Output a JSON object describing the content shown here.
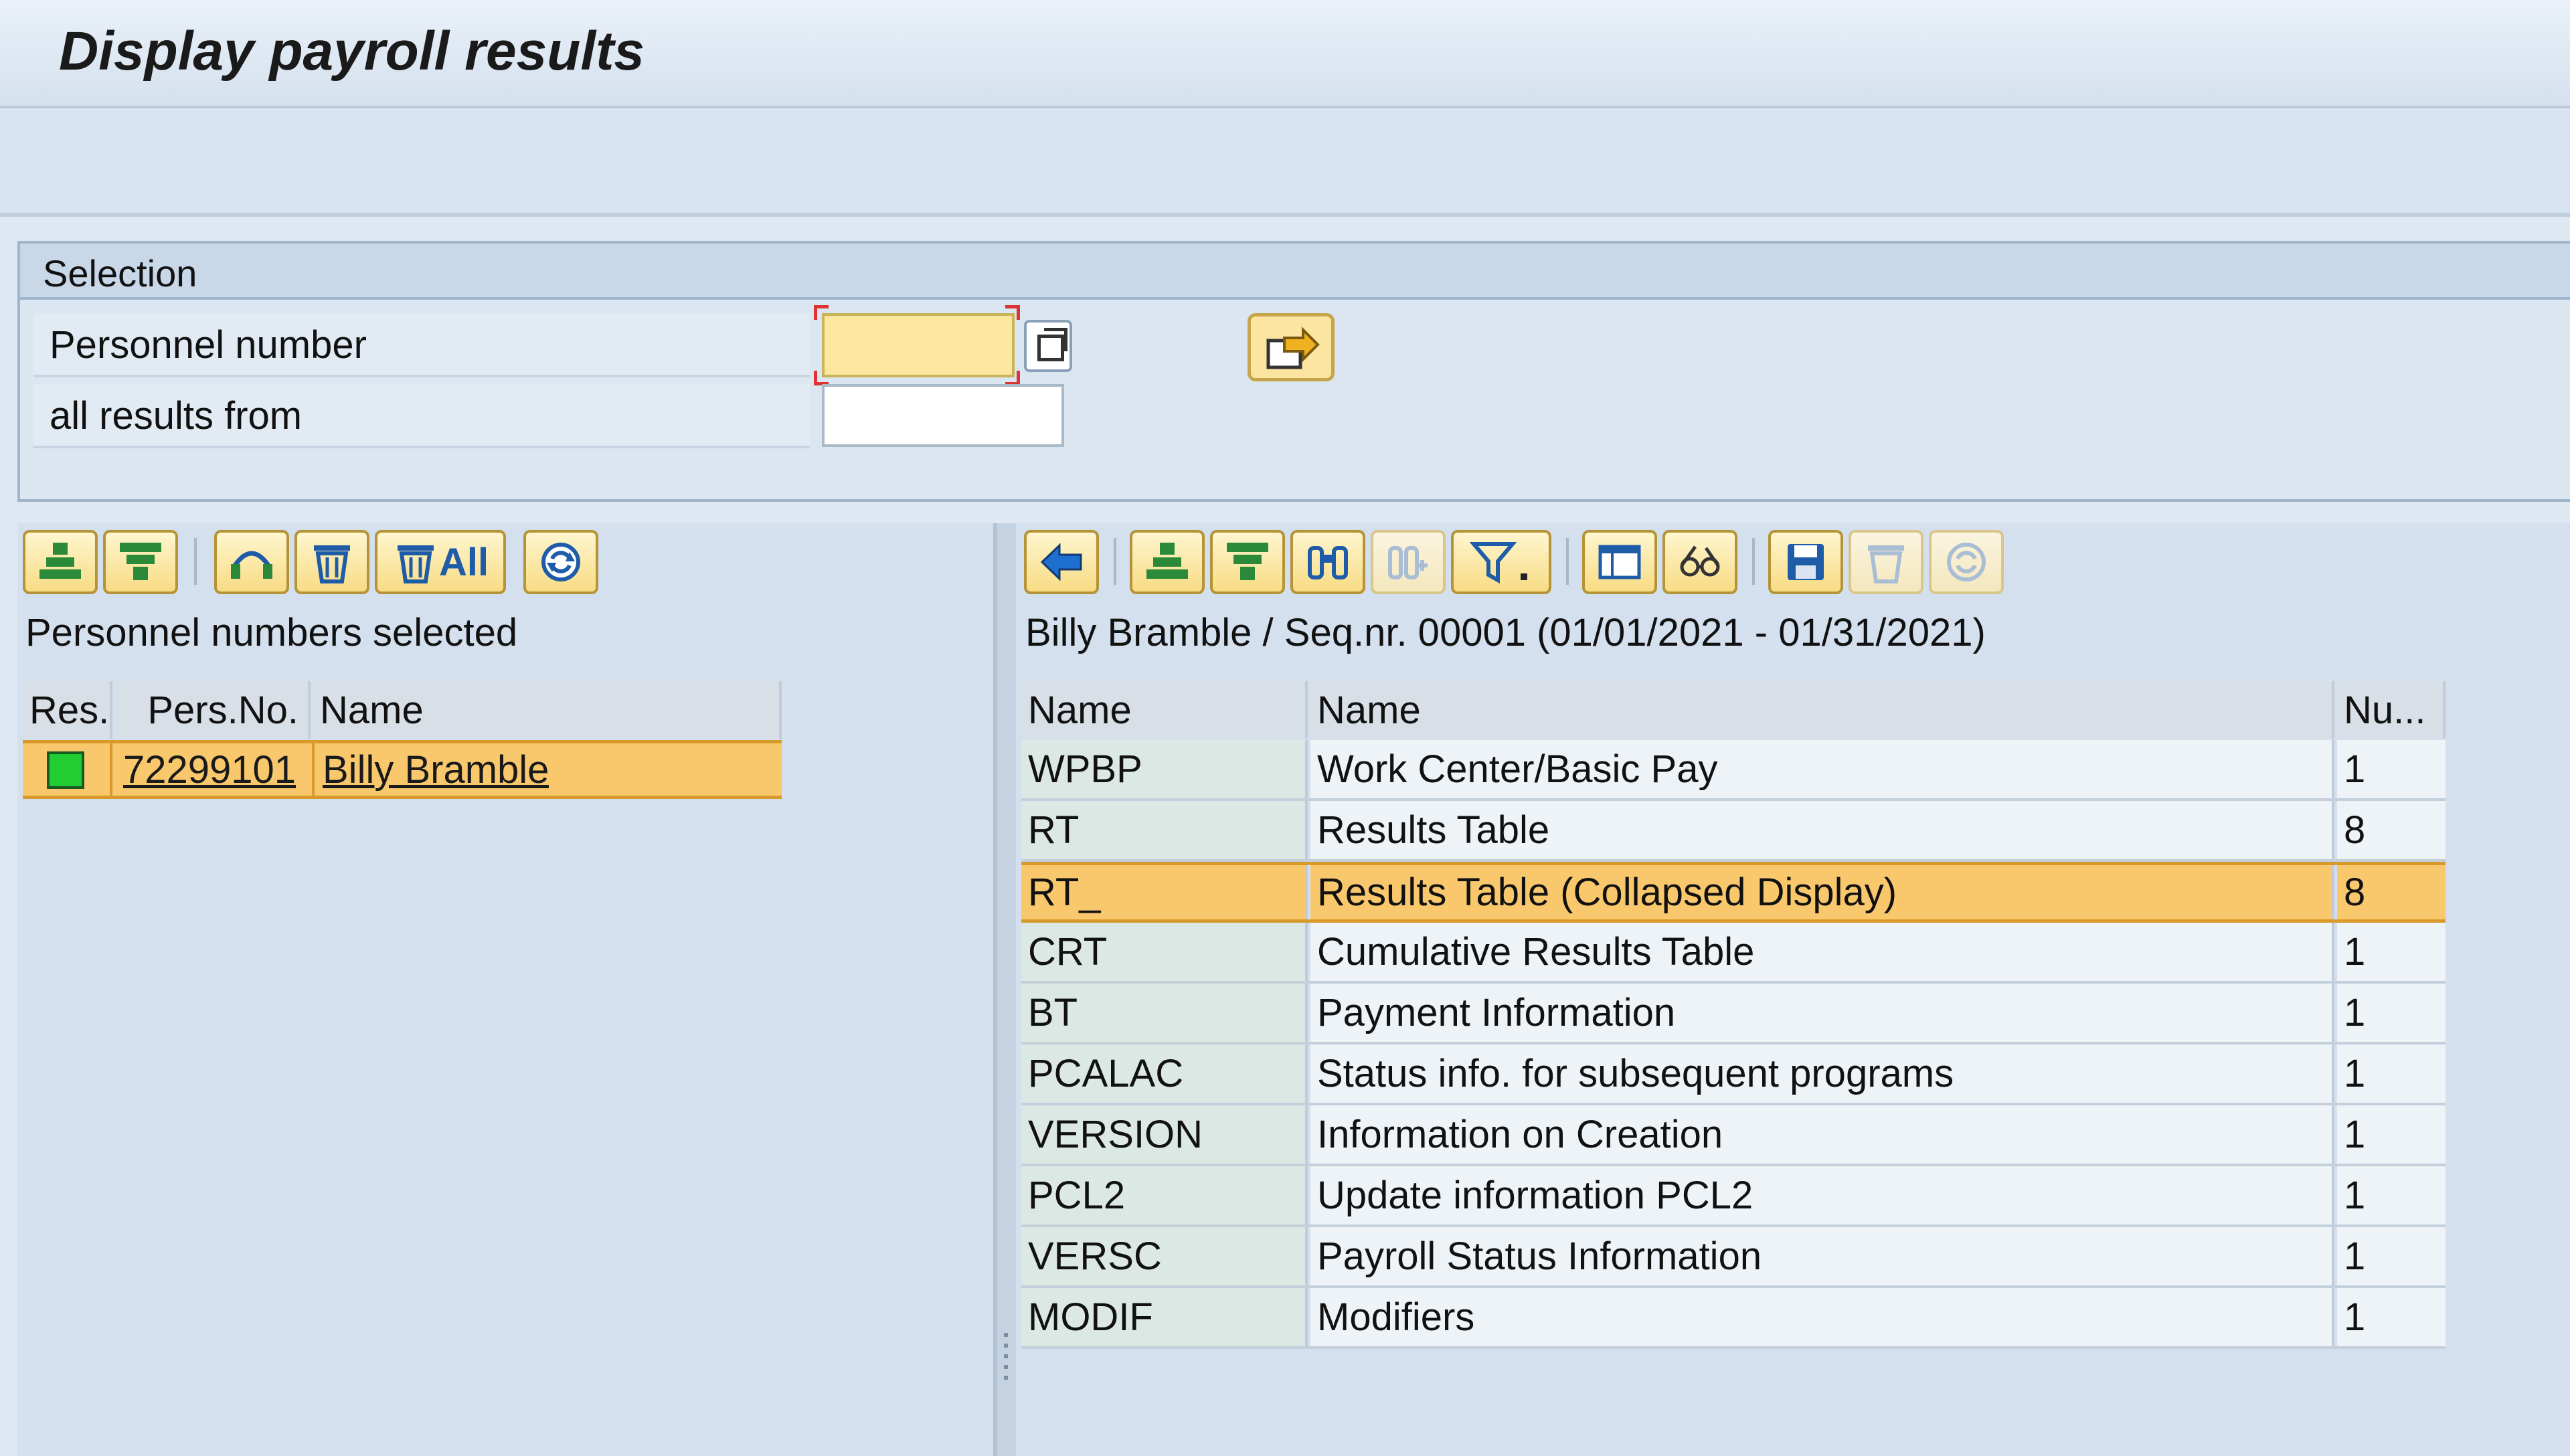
{
  "window": {
    "title": "Display payroll results"
  },
  "selection": {
    "title": "Selection",
    "personnel_number_label": "Personnel number",
    "personnel_number_value": "",
    "all_results_from_label": "all results from",
    "all_results_from_value": ""
  },
  "left_pane": {
    "toolbar": {
      "delete_all_label": "All"
    },
    "title": "Personnel numbers selected",
    "columns": [
      "Res.",
      "Pers.No.",
      "Name"
    ],
    "rows": [
      {
        "status": "green",
        "pers_no": "72299101",
        "name": "Billy Bramble"
      }
    ]
  },
  "right_pane": {
    "title": "Billy Bramble / Seq.nr. 00001 (01/01/2021 - 01/31/2021)",
    "columns": [
      "Name",
      "Name",
      "Nu..."
    ],
    "rows": [
      {
        "key": "WPBP",
        "text": "Work Center/Basic Pay",
        "num": "1"
      },
      {
        "key": "RT",
        "text": "Results Table",
        "num": "8"
      },
      {
        "key": "RT_",
        "text": "Results Table (Collapsed Display)",
        "num": "8"
      },
      {
        "key": "CRT",
        "text": "Cumulative Results Table",
        "num": "1"
      },
      {
        "key": "BT",
        "text": "Payment Information",
        "num": "1"
      },
      {
        "key": "PCALAC",
        "text": "Status info. for subsequent programs",
        "num": "1"
      },
      {
        "key": "VERSION",
        "text": "Information on Creation",
        "num": "1"
      },
      {
        "key": "PCL2",
        "text": "Update information PCL2",
        "num": "1"
      },
      {
        "key": "VERSC",
        "text": "Payroll Status Information",
        "num": "1"
      },
      {
        "key": "MODIF",
        "text": "Modifiers",
        "num": "1"
      }
    ],
    "selected_row": "RT_"
  },
  "colors": {
    "selected_row": "#f9c86c",
    "status_ok": "#22cc33",
    "input_required": "#fbe79d"
  }
}
